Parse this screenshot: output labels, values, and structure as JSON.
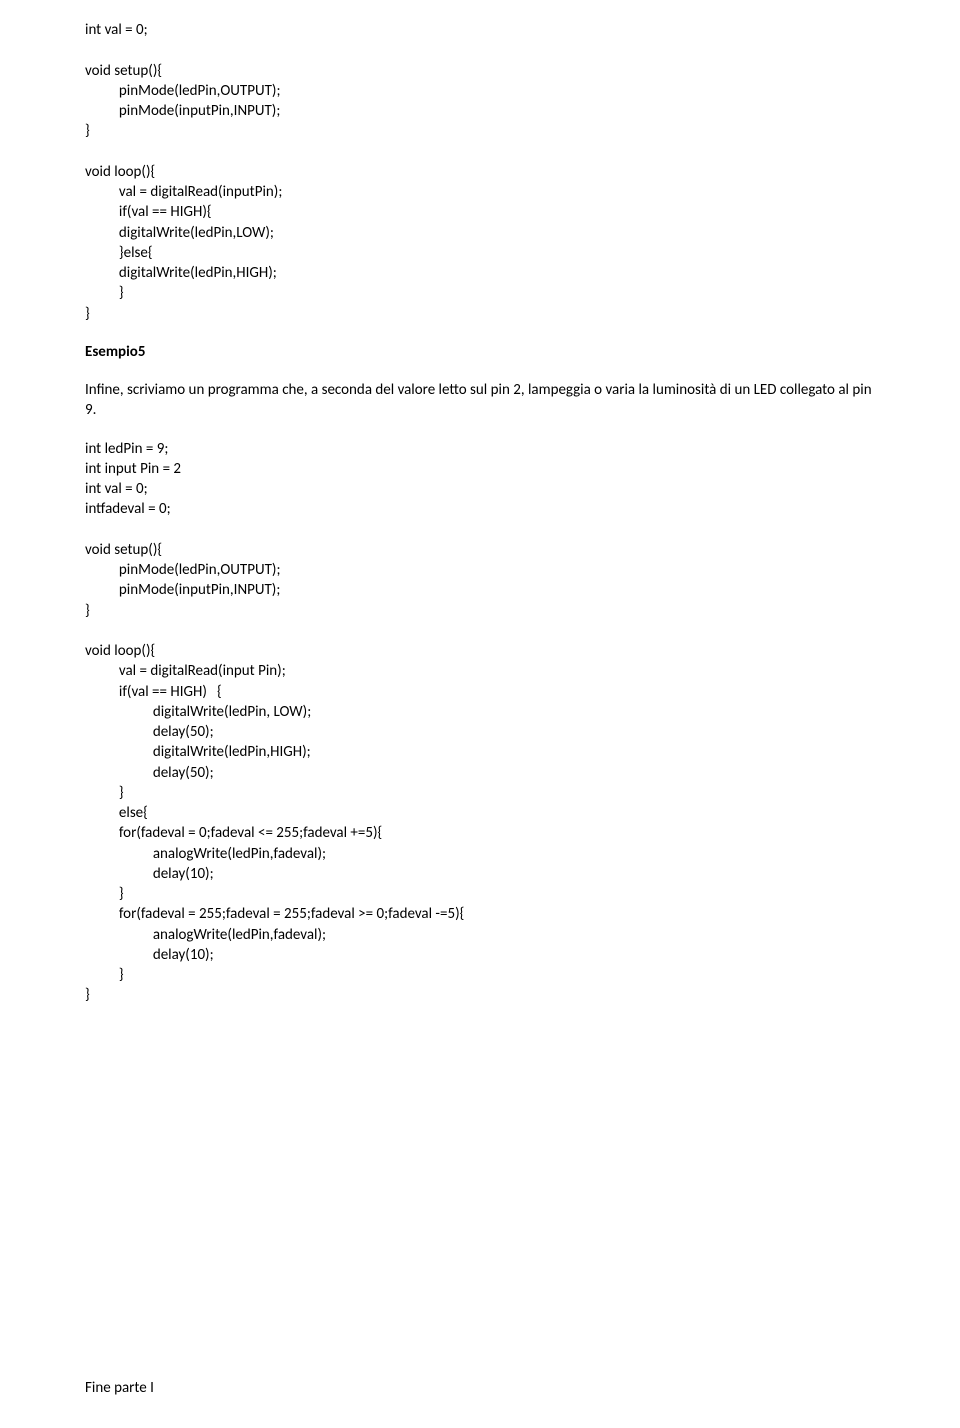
{
  "code1": "int val = 0;\n\nvoid setup(){\n          pinMode(ledPin,OUTPUT);\n          pinMode(inputPin,INPUT);\n}\n\nvoid loop(){\n          val = digitalRead(inputPin);\n          if(val == HIGH){\n          digitalWrite(ledPin,LOW);\n          }else{\n          digitalWrite(ledPin,HIGH);\n          }\n}",
  "heading": "Esempio5",
  "para": "Infine, scriviamo un programma che, a seconda del valore letto sul pin 2, lampeggia o varia la luminosità di un LED collegato al pin 9.",
  "code2": "int ledPin = 9;\nint input Pin = 2\nint val = 0;\nintfadeval = 0;\n\nvoid setup(){\n          pinMode(ledPin,OUTPUT);\n          pinMode(inputPin,INPUT);\n}\n\nvoid loop(){\n          val = digitalRead(input Pin);\n          if(val == HIGH)   {\n                    digitalWrite(ledPin, LOW);\n                    delay(50);\n                    digitalWrite(ledPin,HIGH);\n                    delay(50);\n          }\n          else{\n          for(fadeval = 0;fadeval <= 255;fadeval +=5){\n                    analogWrite(ledPin,fadeval);\n                    delay(10);\n          }\n          for(fadeval = 255;fadeval = 255;fadeval >= 0;fadeval -=5){\n                    analogWrite(ledPin,fadeval);\n                    delay(10);\n          }\n}",
  "footer": "Fine parte I"
}
